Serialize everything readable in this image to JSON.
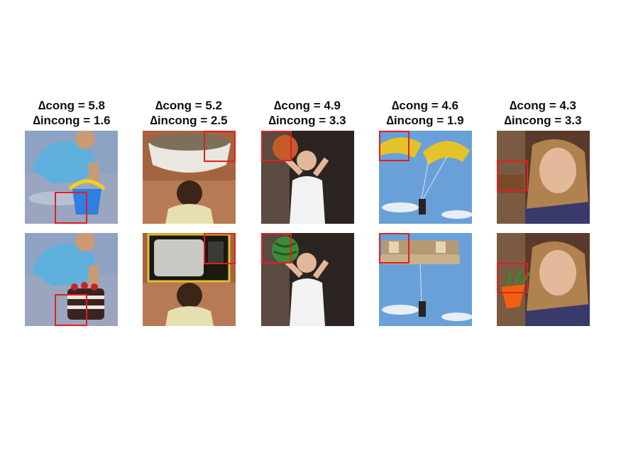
{
  "figure": {
    "columns": [
      {
        "id": "bucket",
        "cong_label": "∆cong = 5.8",
        "incong_label": "∆incong = 1.6",
        "congruent_object": "bucket",
        "incongruent_object": "cake"
      },
      {
        "id": "basin",
        "cong_label": "∆cong = 5.2",
        "incong_label": "∆incong = 2.5",
        "congruent_object": "basin",
        "incongruent_object": "television"
      },
      {
        "id": "basketball",
        "cong_label": "∆cong = 4.9",
        "incong_label": "∆incong = 3.3",
        "congruent_object": "basketball",
        "incongruent_object": "watermelon"
      },
      {
        "id": "parachute",
        "cong_label": "∆cong = 4.6",
        "incong_label": "∆incong = 1.9",
        "congruent_object": "parachute",
        "incongruent_object": "sofa"
      },
      {
        "id": "cup",
        "cong_label": "∆cong = 4.3",
        "incong_label": "∆incong = 3.3",
        "congruent_object": "cup",
        "incongruent_object": "flower pot"
      }
    ],
    "highlight_color": "#e02020"
  }
}
